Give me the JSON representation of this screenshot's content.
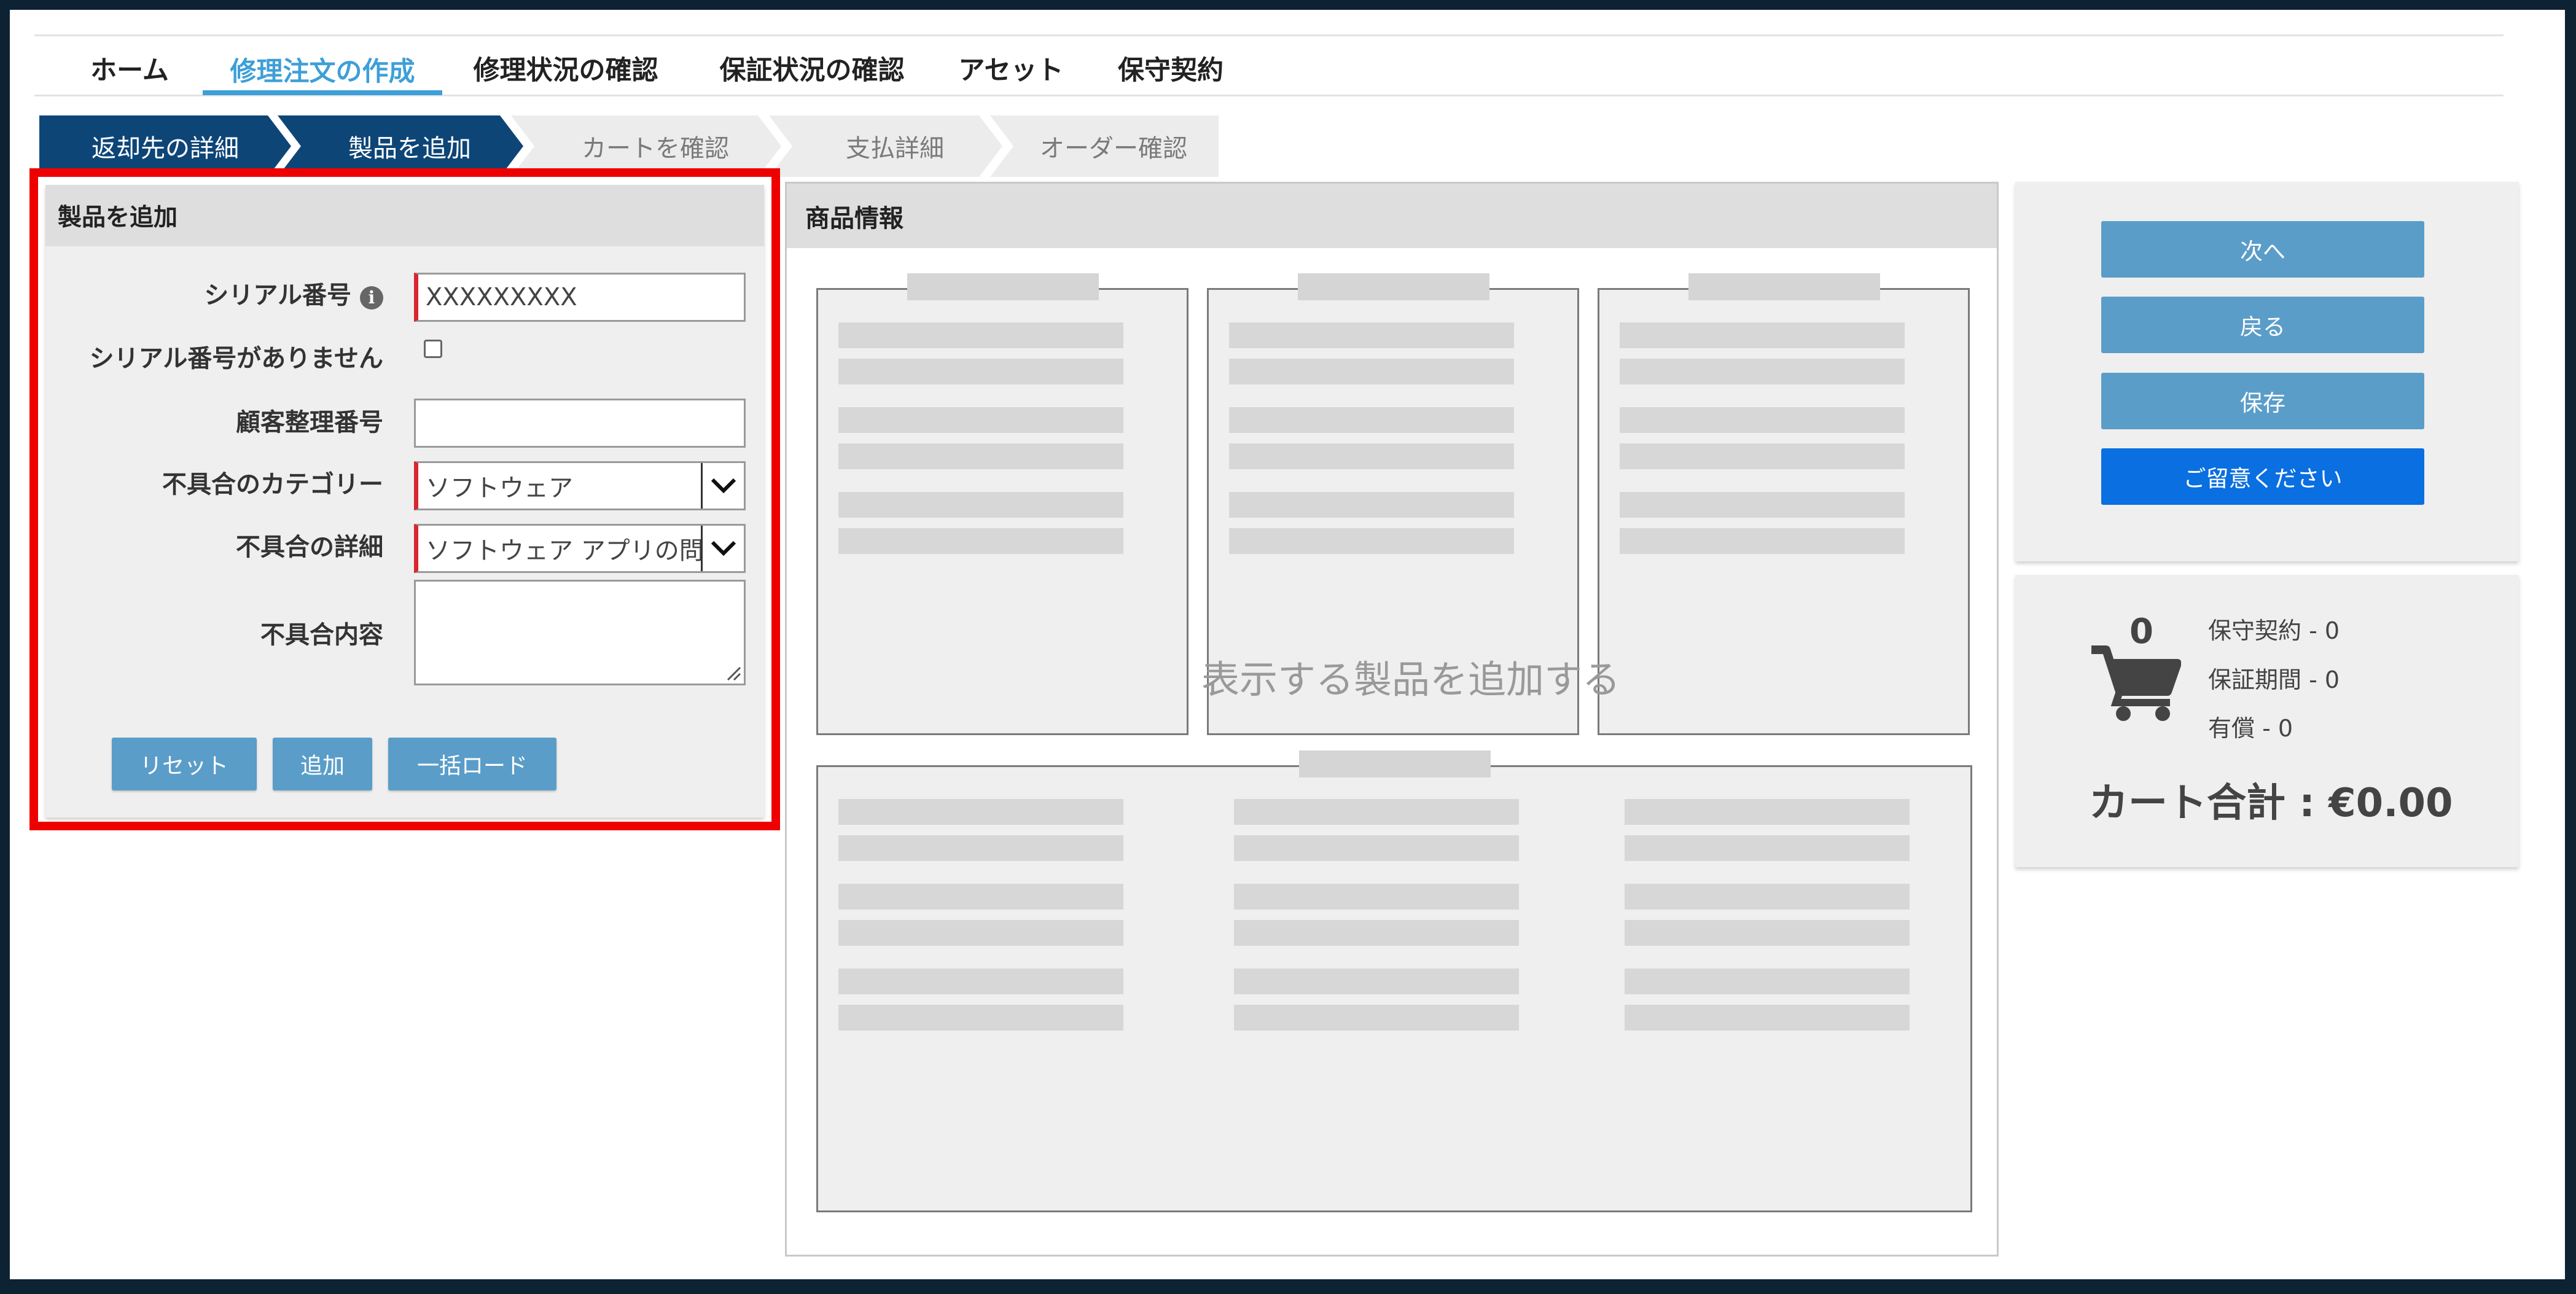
{
  "nav": {
    "tabs": [
      {
        "label": "ホーム"
      },
      {
        "label": "修理注文の作成",
        "active": true
      },
      {
        "label": "修理状況の確認"
      },
      {
        "label": "保証状況の確認"
      },
      {
        "label": "アセット"
      },
      {
        "label": "保守契約"
      }
    ],
    "active_color": "#3d9fd8"
  },
  "breadcrumb": {
    "steps": [
      {
        "label": "返却先の詳細",
        "state": "done"
      },
      {
        "label": "製品を追加",
        "state": "current"
      },
      {
        "label": "カートを確認",
        "state": "todo"
      },
      {
        "label": "支払詳細",
        "state": "todo"
      },
      {
        "label": "オーダー確認",
        "state": "todo"
      }
    ],
    "done_color": "#0e4577"
  },
  "add_product": {
    "title": "製品を追加",
    "serial_label": "シリアル番号",
    "serial_value": "XXXXXXXXX",
    "no_serial_label": "シリアル番号がありません",
    "no_serial_checked": false,
    "customer_ref_label": "顧客整理番号",
    "customer_ref_value": "",
    "category_label": "不具合のカテゴリー",
    "category_value": "ソフトウェア",
    "detail_label": "不具合の詳細",
    "detail_value": "ソフトウェア アプリの問",
    "description_label": "不具合内容",
    "description_value": "",
    "buttons": {
      "reset": "リセット",
      "add": "追加",
      "bulk": "一括ロード"
    },
    "highlight_color": "#ee0000"
  },
  "product_info": {
    "title": "商品情報",
    "placeholder": "表示する製品を追加する"
  },
  "actions": {
    "next": "次へ",
    "back": "戻る",
    "save": "保存",
    "notice": "ご留意ください",
    "button_color": "#5b9dc9",
    "notice_color": "#0a6fe0"
  },
  "cart": {
    "count": "0",
    "contract": "保守契約 - 0",
    "warranty": "保証期間 - 0",
    "paid": "有償 - 0",
    "total": "カート合計 : €0.00",
    "icon": "cart-icon"
  }
}
